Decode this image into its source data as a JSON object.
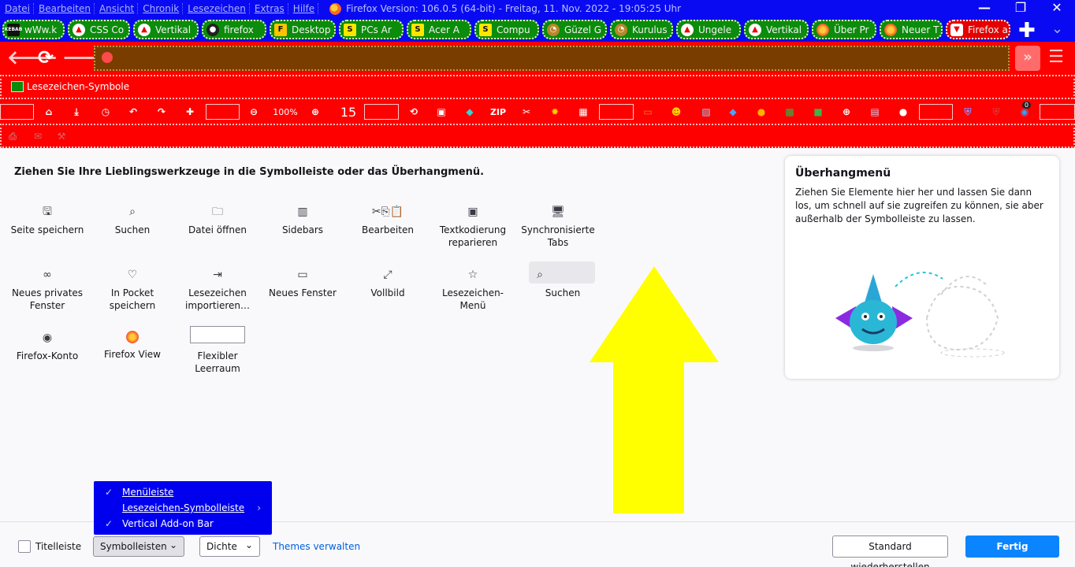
{
  "window": {
    "menu": [
      "Datei",
      "Bearbeiten",
      "Ansicht",
      "Chronik",
      "Lesezeichen",
      "Extras",
      "Hilfe"
    ],
    "title": "Firefox Version: 106.0.5 (64-bit)  -  Freitag, 11. Nov. 2022 - 19:05:25 Uhr",
    "controls": {
      "minimize": "—",
      "restore": "❐",
      "close": "✕"
    }
  },
  "tabs": [
    {
      "label": "wWw.k",
      "icon": "kebab-icon"
    },
    {
      "label": "CSS Co",
      "icon": "fire-icon"
    },
    {
      "label": "Vertikal",
      "icon": "fire-icon"
    },
    {
      "label": "firefox",
      "icon": "github-icon"
    },
    {
      "label": "Desktop",
      "icon": "f-icon"
    },
    {
      "label": "PCs Ar",
      "icon": "s-icon"
    },
    {
      "label": "Acer A",
      "icon": "s-icon"
    },
    {
      "label": "Compu",
      "icon": "s-icon"
    },
    {
      "label": "Güzel G",
      "icon": "owl-icon"
    },
    {
      "label": "Kurulus",
      "icon": "owl-icon"
    },
    {
      "label": "Ungele",
      "icon": "fire-icon"
    },
    {
      "label": "Vertikal",
      "icon": "fire-icon"
    },
    {
      "label": "Über Pr",
      "icon": "firefox-icon"
    },
    {
      "label": "Neuer T",
      "icon": "firefox-icon"
    },
    {
      "label": "Firefox a",
      "icon": "bubble-icon"
    }
  ],
  "tabs_controls": {
    "new_tab": "✚",
    "list_all": "⌄"
  },
  "nav": {
    "back": "🡐",
    "reload": "⟳",
    "forward": "🡒",
    "overflow": "»",
    "menu": "☰"
  },
  "bookmarks": {
    "label": "Lesezeichen-Symbole"
  },
  "addon_bar": {
    "zoom_level": "100%",
    "counter": "15",
    "zip_label": "ZIP",
    "badge_count": "0"
  },
  "customize": {
    "intro": "Ziehen Sie Ihre Lieblingswerkzeuge in die Symbolleiste oder das Überhangmenü.",
    "items": [
      {
        "label": "Seite speichern",
        "icon": "save-page-icon",
        "glyph": "🖫"
      },
      {
        "label": "Suchen",
        "icon": "search-icon",
        "glyph": "⌕"
      },
      {
        "label": "Datei öffnen",
        "icon": "folder-open-icon",
        "glyph": "🗀"
      },
      {
        "label": "Sidebars",
        "icon": "sidebar-icon",
        "glyph": "▥"
      },
      {
        "label": "Bearbeiten",
        "icon": "edit-icon",
        "glyph": "✂⎘📋"
      },
      {
        "label": "Textkodierung reparieren",
        "icon": "text-encoding-icon",
        "glyph": "▣"
      },
      {
        "label": "Synchronisierte Tabs",
        "icon": "synced-tabs-icon",
        "glyph": "🖥"
      },
      {
        "label": "Neues privates Fenster",
        "icon": "private-window-icon",
        "glyph": "∞"
      },
      {
        "label": "In Pocket speichern",
        "icon": "pocket-icon",
        "glyph": "♡"
      },
      {
        "label": "Lesezeichen importieren…",
        "icon": "import-icon",
        "glyph": "⇥"
      },
      {
        "label": "Neues Fenster",
        "icon": "new-window-icon",
        "glyph": "▭"
      },
      {
        "label": "Vollbild",
        "icon": "fullscreen-icon",
        "glyph": "⤢"
      },
      {
        "label": "Lesezeichen-Menü",
        "icon": "bookmarks-menu-icon",
        "glyph": "☆"
      },
      {
        "label": "Suchen",
        "icon": "search-field-icon",
        "glyph": "⌕"
      },
      {
        "label": "Firefox-Konto",
        "icon": "account-icon",
        "glyph": "◉"
      },
      {
        "label": "Firefox View",
        "icon": "firefox-view-icon",
        "glyph": ""
      },
      {
        "label": "Flexibler Leerraum",
        "icon": "flexible-space-icon",
        "glyph": ""
      }
    ]
  },
  "overflow_panel": {
    "title": "Überhangmenü",
    "description": "Ziehen Sie Elemente hier her und lassen Sie dann los, um schnell auf sie zugreifen zu können, sie aber außerhalb der Symbolleiste zu lassen."
  },
  "footer": {
    "titlebar_label": "Titelleiste",
    "toolbars_label": "Symbolleisten",
    "density_label": "Dichte",
    "themes_link": "Themes verwalten",
    "restore_label": "Standard wiederherstellen",
    "done_label": "Fertig"
  },
  "toolbars_popup": {
    "items": [
      {
        "label": "Menüleiste",
        "checked": true
      },
      {
        "label": "Lesezeichen-Symbolleiste",
        "checked": false,
        "submenu": true
      },
      {
        "label": "Vertical Add-on Bar",
        "checked": true
      }
    ]
  },
  "colors": {
    "titlebar_bg": "#0a0af2",
    "toolbar_bg": "#ff0000",
    "urlbar_bg": "#7a3d00",
    "tab_bg": "#0c8c0c",
    "active_tab_bg": "#e40000",
    "arrow": "#ffff00",
    "primary_button": "#0a84ff",
    "popup_bg": "#0000ee"
  }
}
